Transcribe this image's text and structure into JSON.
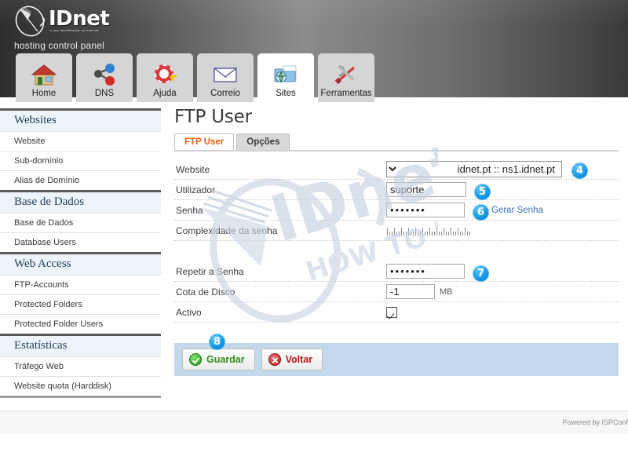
{
  "header": {
    "brand": "IDnet",
    "brand_tagline": "o seu identificador na internet",
    "subtitle": "hosting control panel",
    "logo_icon": "idnet-swoosh-logo"
  },
  "nav": {
    "tabs": [
      {
        "label": "Home",
        "icon": "house-icon",
        "active": false
      },
      {
        "label": "DNS",
        "icon": "molecule-icon",
        "active": false
      },
      {
        "label": "Ajuda",
        "icon": "lifering-help-icon",
        "active": false
      },
      {
        "label": "Correio",
        "icon": "envelope-icon",
        "active": false
      },
      {
        "label": "Sites",
        "icon": "folder-globe-icon",
        "active": true
      },
      {
        "label": "Ferramentas",
        "icon": "tools-icon",
        "active": false
      }
    ]
  },
  "sidebar": {
    "sections": [
      {
        "title": "Websites",
        "items": [
          "Website",
          "Sub-domínio",
          "Alias de Domínio"
        ]
      },
      {
        "title": "Base de Dados",
        "items": [
          "Base de Dados",
          "Database Users"
        ]
      },
      {
        "title": "Web Access",
        "items": [
          "FTP-Accounts",
          "Protected Folders",
          "Protected Folder Users"
        ]
      },
      {
        "title": "Estatísticas",
        "items": [
          "Tráfego Web",
          "Website quota (Harddisk)"
        ]
      }
    ]
  },
  "main": {
    "title": "FTP User",
    "tabs": [
      {
        "label": "FTP User",
        "active": true
      },
      {
        "label": "Opções",
        "active": false
      }
    ],
    "fields": {
      "website": {
        "label": "Website",
        "value": "idnet.pt :: ns1.idnet.pt",
        "badge": "4"
      },
      "user": {
        "label": "Utilizador",
        "value": "suporte",
        "badge": "5"
      },
      "password": {
        "label": "Senha",
        "value": "•••••••",
        "link": "Gerar Senha",
        "badge": "6"
      },
      "complexity": {
        "label": "Complexidade da senha",
        "value": ""
      },
      "repeat_password": {
        "label": "Repetir a Senha",
        "value": "•••••••",
        "badge": "7"
      },
      "quota": {
        "label": "Cota de Disco",
        "value": "-1",
        "unit": "MB"
      },
      "active": {
        "label": "Activo",
        "checked": true
      }
    },
    "buttons": {
      "save": {
        "label": "Guardar",
        "icon": "green-check-icon",
        "badge": "8"
      },
      "back": {
        "label": "Voltar",
        "icon": "red-cross-icon"
      }
    }
  },
  "watermark": {
    "brand": "IDnet",
    "text": "HOW TO DO"
  },
  "footer": {
    "powered_by": "Powered by ISPConf"
  },
  "colors": {
    "accent_orange": "#e8601c",
    "badge_blue": "#0c93e4",
    "link_blue": "#3b73b9",
    "save_green": "#2f8f16",
    "back_red": "#c11717",
    "button_bar": "#c4d8ec",
    "section_bg": "#eef4fb"
  }
}
